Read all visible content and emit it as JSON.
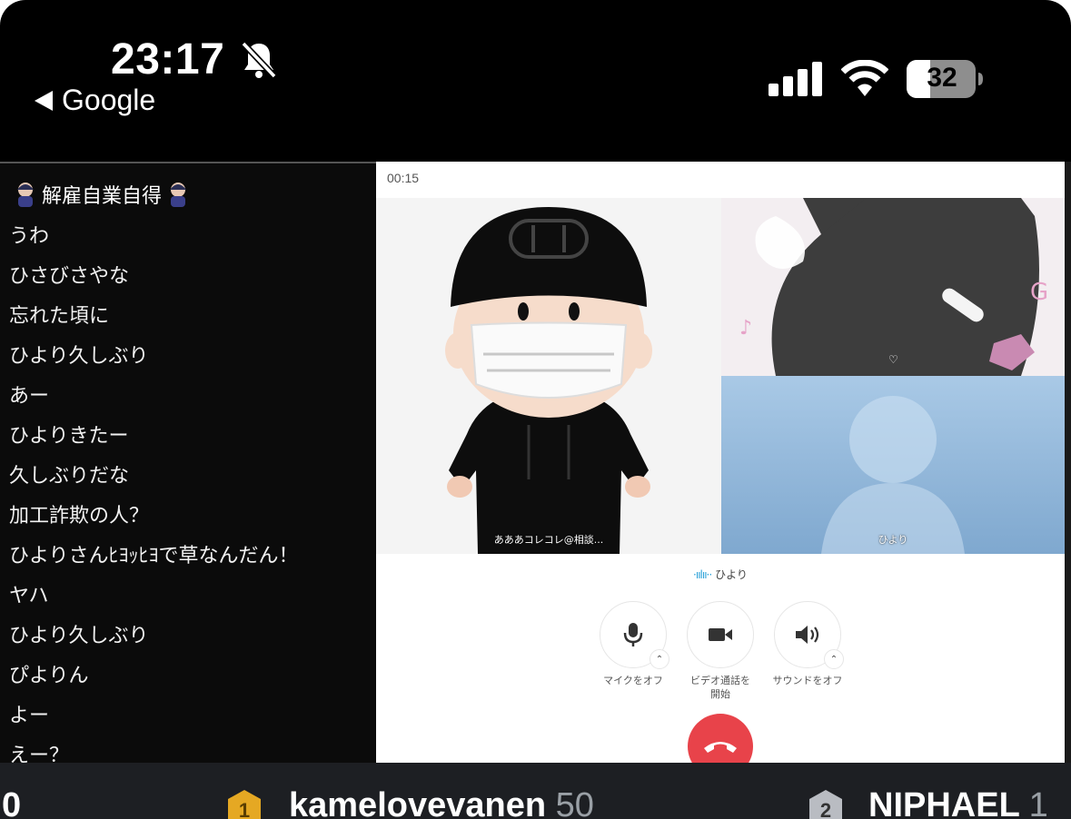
{
  "status_bar": {
    "time": "23:17",
    "back_label": "Google",
    "battery_level": "32"
  },
  "chat": {
    "header": "解雇自業自得",
    "messages": [
      "うわ",
      "ひさびさやな",
      "忘れた頃に",
      "ひより久しぶり",
      "あー",
      "ひよりきたー",
      "久しぶりだな",
      "加工詐欺の人？",
      "ひよりさんﾋﾖｯﾋﾖで草なんだん！",
      "ヤハ",
      "ひより久しぶり",
      "ぴよりん",
      "よー",
      "えー？"
    ]
  },
  "call": {
    "elapsed": "00:15",
    "tiles": {
      "main_label": "あああコレコレ@相談...",
      "hiyori_label": "ひより"
    },
    "speaking": "ひより",
    "controls": {
      "mic": "マイクをオフ",
      "video_line1": "ビデオ通話を",
      "video_line2": "開始",
      "sound": "サウンドをオフ"
    }
  },
  "leaderboard": {
    "partial_score": "0",
    "entries": [
      {
        "rank": "1",
        "name": "kamelovevanen",
        "score": "50"
      },
      {
        "rank": "2",
        "name": "NIPHAEL",
        "score": "1"
      }
    ]
  },
  "colors": {
    "hangup": "#e8434a",
    "medal_gold": "#e5a823",
    "medal_silver": "#b9bcc2",
    "chat_bg": "#0b0b0b"
  }
}
